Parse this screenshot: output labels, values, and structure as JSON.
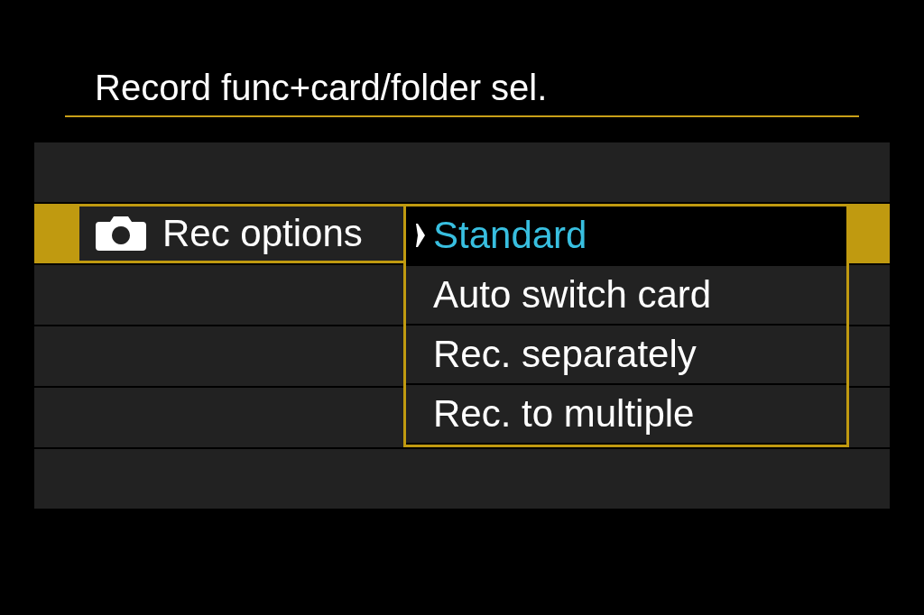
{
  "title": "Record func+card/folder sel.",
  "menu": {
    "items": [
      {
        "label": "Rec options",
        "selected": true
      }
    ]
  },
  "dropdown": {
    "options": [
      {
        "label": "Standard",
        "selected": true
      },
      {
        "label": "Auto switch card",
        "selected": false
      },
      {
        "label": "Rec. separately",
        "selected": false
      },
      {
        "label": "Rec. to multiple",
        "selected": false
      }
    ]
  }
}
